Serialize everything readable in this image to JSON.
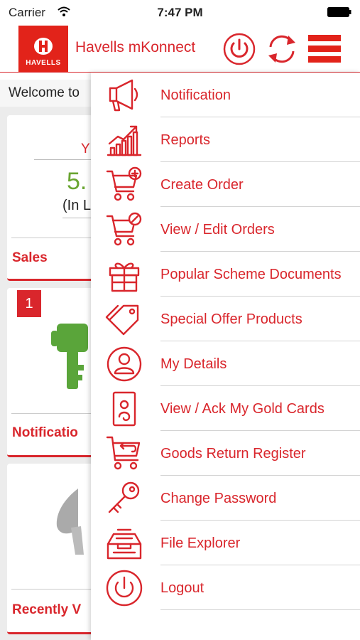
{
  "status_bar": {
    "carrier": "Carrier",
    "time": "7:47 PM"
  },
  "header": {
    "logo_text": "HAVELLS",
    "title": "Havells mKonnect",
    "icons": [
      "power-icon",
      "sync-icon",
      "hamburger-menu-icon"
    ]
  },
  "dashboard": {
    "welcome": "Welcome to",
    "sales_card": {
      "ytd": "Y",
      "value": "5.",
      "unit": "(In L",
      "label": "Sales"
    },
    "notification_card": {
      "badge": "1",
      "label": "Notificatio"
    },
    "recent_card": {
      "label": "Recently V"
    }
  },
  "menu": {
    "items": [
      {
        "label": "Notification",
        "icon": "megaphone-icon"
      },
      {
        "label": "Reports",
        "icon": "chart-icon"
      },
      {
        "label": "Create Order",
        "icon": "cart-add-icon"
      },
      {
        "label": "View / Edit Orders",
        "icon": "cart-edit-icon"
      },
      {
        "label": "Popular Scheme Documents",
        "icon": "gift-icon"
      },
      {
        "label": "Special Offer Products",
        "icon": "tag-icon"
      },
      {
        "label": "My Details",
        "icon": "user-icon"
      },
      {
        "label": "View / Ack My Gold Cards",
        "icon": "gold-card-icon"
      },
      {
        "label": "Goods Return Register",
        "icon": "cart-return-icon"
      },
      {
        "label": "Change Password",
        "icon": "key-icon"
      },
      {
        "label": "File Explorer",
        "icon": "file-tray-icon"
      },
      {
        "label": "Logout",
        "icon": "logout-icon"
      }
    ]
  },
  "colors": {
    "brand_red": "#d9262c",
    "logo_red": "#e2231a",
    "sales_green": "#6aa531",
    "key_green": "#5aa53a"
  }
}
